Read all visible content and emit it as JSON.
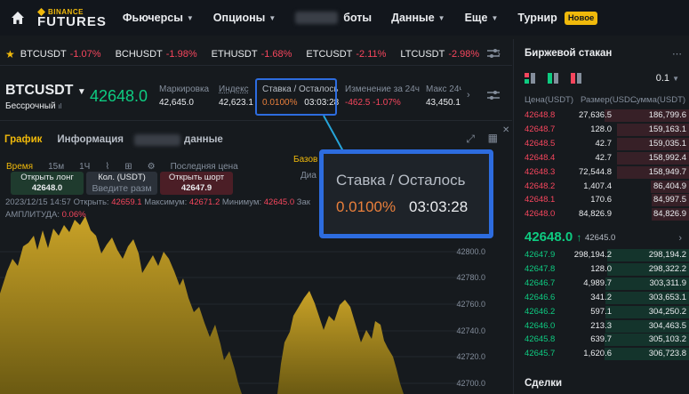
{
  "nav": {
    "logo_top": "BINANCE",
    "logo_bottom": "FUTURES",
    "items": [
      {
        "label": "Фьючерсы"
      },
      {
        "label": "Опционы"
      },
      {
        "label": "боты"
      },
      {
        "label": "Данные"
      },
      {
        "label": "Еще"
      },
      {
        "label": "Турнир"
      }
    ],
    "badge": "Новое"
  },
  "ticker": [
    {
      "symbol": "BTCUSDT",
      "change": "-1.07%"
    },
    {
      "symbol": "BCHUSDT",
      "change": "-1.98%"
    },
    {
      "symbol": "ETHUSDT",
      "change": "-1.68%"
    },
    {
      "symbol": "ETCUSDT",
      "change": "-2.11%"
    },
    {
      "symbol": "LTCUSDT",
      "change": "-2.98%"
    }
  ],
  "symbol": {
    "name": "BTCUSDT",
    "type": "Бессрочный",
    "last_price": "42648.0",
    "mark_label": "Маркировка",
    "mark_value": "42,645.0",
    "index_label": "Индекс",
    "index_value": "42,623.1",
    "funding_label": "Ставка / Осталось",
    "funding_rate": "0.0100%",
    "funding_countdown": "03:03:28",
    "change_label": "Изменение за 24ч",
    "change_value": "-462.5 -1.07%",
    "max_label": "Макс 24ч",
    "max_value": "43,450.1"
  },
  "chart_tabs": {
    "chart": "График",
    "info": "Информация",
    "data": "данные"
  },
  "toolbar": {
    "time": "Время",
    "m15": "15м",
    "h1": "1Ч",
    "last_price": "Последняя цена",
    "base": "Базов",
    "dia": "Диа"
  },
  "trade": {
    "long_label": "Открыть лонг",
    "long_price": "42648.0",
    "qty_label": "Кол. (USDT)",
    "qty_placeholder": "Введите разм",
    "short_label": "Открыть шорт",
    "short_price": "42647.9"
  },
  "ohlc": {
    "date": "2023/12/15 14:57",
    "open_label": "Открыть:",
    "open": "42659.1",
    "max_label": "Максимум:",
    "max": "42671.2",
    "min_label": "Минимум:",
    "min": "42645.0",
    "close_label": "Зак",
    "ampl_label": "АМПЛИТУДА:",
    "ampl": "0.06%"
  },
  "y_axis": [
    "42800.0",
    "42780.0",
    "42760.0",
    "42740.0",
    "42720.0",
    "42700.0"
  ],
  "callout": {
    "title": "Ставка / Осталось",
    "rate": "0.0100%",
    "countdown": "03:03:28"
  },
  "orderbook": {
    "title": "Биржевой стакан",
    "precision": "0.1",
    "col_price": "Цена(USDT)",
    "col_size": "Размер(USD...",
    "col_sum": "Сумма(USDT)",
    "asks": [
      {
        "price": "42648.8",
        "size": "27,636.5",
        "sum": "186,799.6",
        "depth": 1.0
      },
      {
        "price": "42648.7",
        "size": "128.0",
        "sum": "159,163.1",
        "depth": 0.85
      },
      {
        "price": "42648.5",
        "size": "42.7",
        "sum": "159,035.1",
        "depth": 0.85
      },
      {
        "price": "42648.4",
        "size": "42.7",
        "sum": "158,992.4",
        "depth": 0.85
      },
      {
        "price": "42648.3",
        "size": "72,544.8",
        "sum": "158,949.7",
        "depth": 0.85
      },
      {
        "price": "42648.2",
        "size": "1,407.4",
        "sum": "86,404.9",
        "depth": 0.46
      },
      {
        "price": "42648.1",
        "size": "170.6",
        "sum": "84,997.5",
        "depth": 0.45
      },
      {
        "price": "42648.0",
        "size": "84,826.9",
        "sum": "84,826.9",
        "depth": 0.45
      }
    ],
    "mid_price": "42648.0",
    "mid_arrow": "↑",
    "mid_sub": "42645.0",
    "bids": [
      {
        "price": "42647.9",
        "size": "298,194.2",
        "sum": "298,194.2",
        "depth": 0.97
      },
      {
        "price": "42647.8",
        "size": "128.0",
        "sum": "298,322.2",
        "depth": 0.97
      },
      {
        "price": "42646.7",
        "size": "4,989.7",
        "sum": "303,311.9",
        "depth": 0.99
      },
      {
        "price": "42646.6",
        "size": "341.2",
        "sum": "303,653.1",
        "depth": 0.99
      },
      {
        "price": "42646.2",
        "size": "597.1",
        "sum": "304,250.2",
        "depth": 0.99
      },
      {
        "price": "42646.0",
        "size": "213.3",
        "sum": "304,463.5",
        "depth": 0.99
      },
      {
        "price": "42645.8",
        "size": "639.7",
        "sum": "305,103.2",
        "depth": 1.0
      },
      {
        "price": "42645.7",
        "size": "1,620.6",
        "sum": "306,723.8",
        "depth": 1.0
      }
    ],
    "deals_title": "Сделки"
  },
  "colors": {
    "accent": "#f0b90b",
    "up": "#0ecb81",
    "down": "#f6465d",
    "highlight": "#2d6cdf"
  }
}
